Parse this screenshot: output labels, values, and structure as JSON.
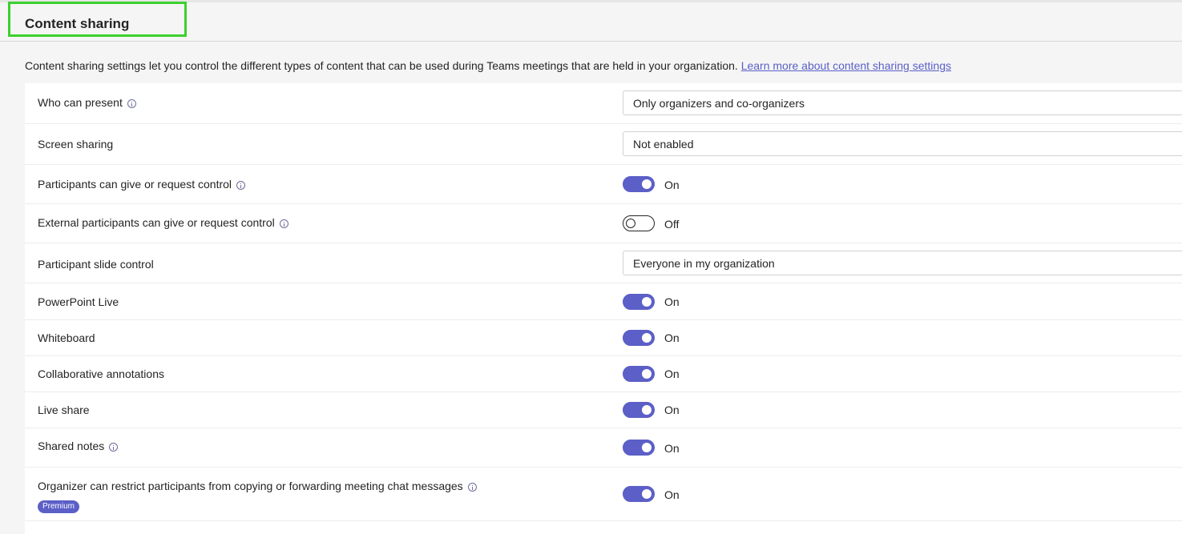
{
  "section": {
    "title": "Content sharing",
    "description": "Content sharing settings let you control the different types of content that can be used during Teams meetings that are held in your organization.",
    "learn_more": "Learn more about content sharing settings"
  },
  "settings": [
    {
      "label": "Who can present",
      "info": true,
      "control": "select",
      "value": "Only organizers and co-organizers"
    },
    {
      "label": "Screen sharing",
      "info": false,
      "control": "select",
      "value": "Not enabled"
    },
    {
      "label": "Participants can give or request control",
      "info": true,
      "control": "toggle",
      "state": true,
      "value": "On"
    },
    {
      "label": "External participants can give or request control",
      "info": true,
      "control": "toggle",
      "state": false,
      "value": "Off"
    },
    {
      "label": "Participant slide control",
      "info": false,
      "control": "select",
      "value": "Everyone in my organization"
    },
    {
      "label": "PowerPoint Live",
      "info": false,
      "control": "toggle",
      "state": true,
      "value": "On"
    },
    {
      "label": "Whiteboard",
      "info": false,
      "control": "toggle",
      "state": true,
      "value": "On"
    },
    {
      "label": "Collaborative annotations",
      "info": false,
      "control": "toggle",
      "state": true,
      "value": "On"
    },
    {
      "label": "Live share",
      "info": false,
      "control": "toggle",
      "state": true,
      "value": "On"
    },
    {
      "label": "Shared notes",
      "info": true,
      "control": "toggle",
      "state": true,
      "value": "On"
    },
    {
      "label": "Organizer can restrict participants from copying or forwarding meeting chat messages",
      "info": true,
      "control": "toggle",
      "state": true,
      "value": "On",
      "badge": "Premium"
    }
  ],
  "colors": {
    "accent": "#5b5fc7",
    "highlight": "#3bd12d"
  }
}
